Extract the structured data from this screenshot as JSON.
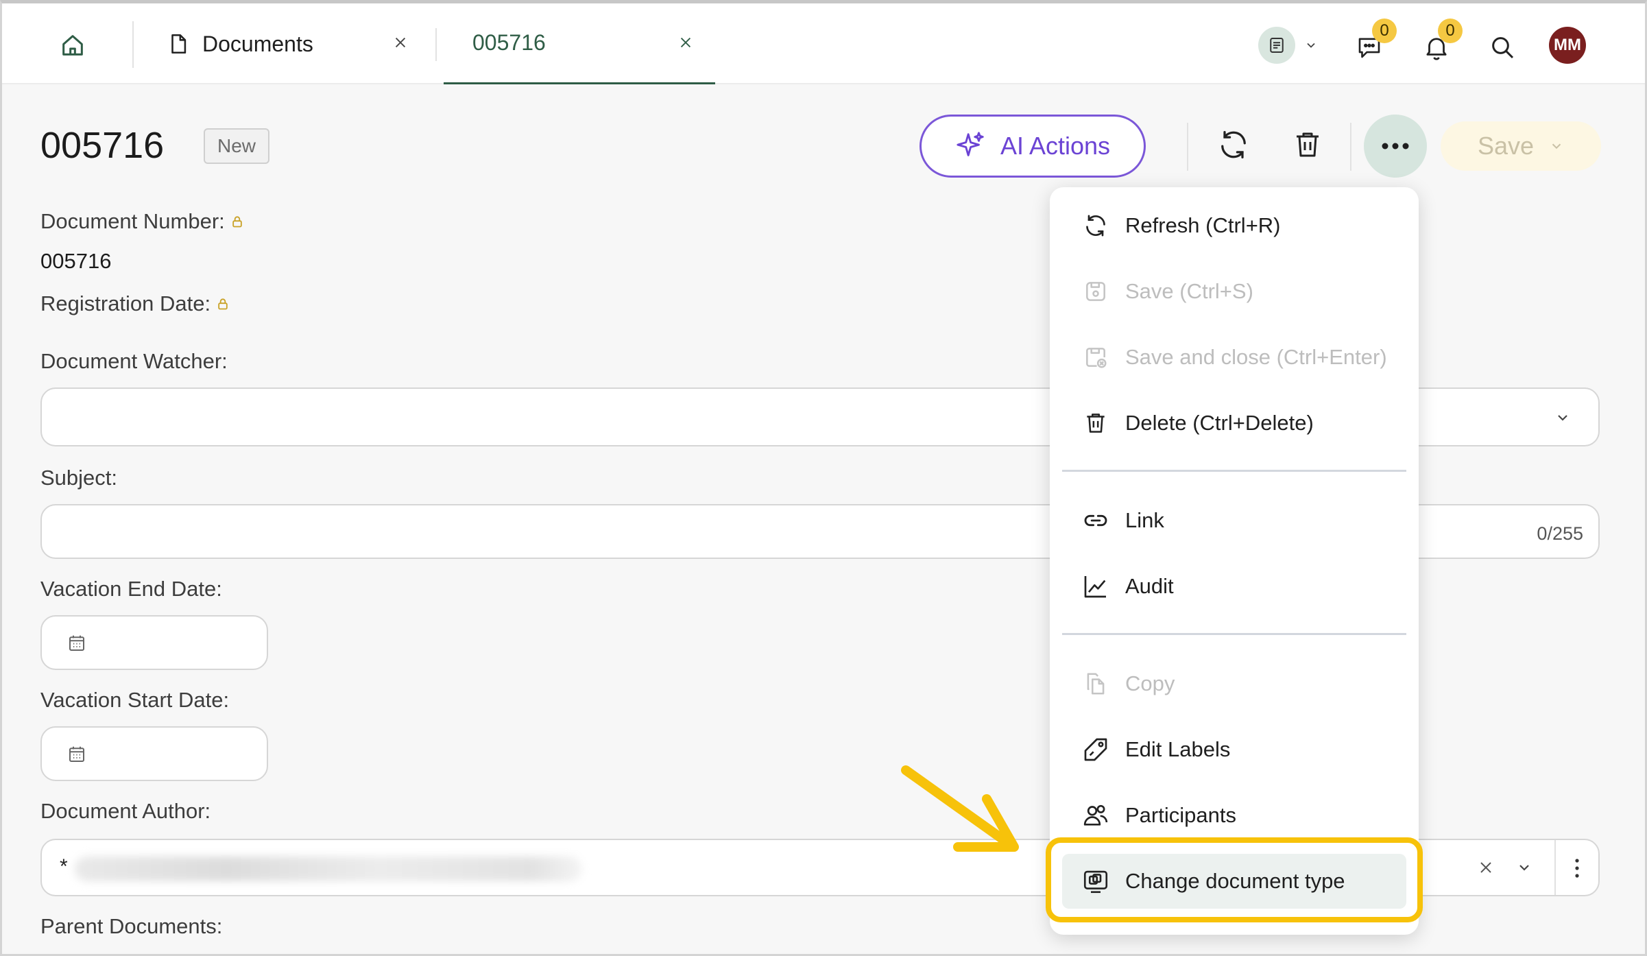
{
  "tabs": [
    {
      "label": "Documents"
    },
    {
      "label": "005716"
    }
  ],
  "notifications": {
    "chat_count": "0",
    "bell_count": "0"
  },
  "user": {
    "initials": "MM"
  },
  "header": {
    "title": "005716",
    "status": "New",
    "ai_label": "AI Actions",
    "save_label": "Save"
  },
  "form": {
    "doc_number_label": "Document Number:",
    "doc_number_value": "005716",
    "reg_date_label": "Registration Date:",
    "watcher_label": "Document Watcher:",
    "subject_label": "Subject:",
    "subject_counter": "0/255",
    "vac_end_label": "Vacation End Date:",
    "vac_start_label": "Vacation Start Date:",
    "author_label": "Document Author:",
    "author_required": "*",
    "parent_label": "Parent Documents:"
  },
  "menu": {
    "items": [
      {
        "label": "Refresh (Ctrl+R)",
        "icon": "refresh-icon",
        "enabled": true
      },
      {
        "label": "Save (Ctrl+S)",
        "icon": "save-icon",
        "enabled": false
      },
      {
        "label": "Save and close (Ctrl+Enter)",
        "icon": "save-close-icon",
        "enabled": false
      },
      {
        "label": "Delete (Ctrl+Delete)",
        "icon": "trash-icon",
        "enabled": true
      },
      {
        "label": "Link",
        "icon": "link-icon",
        "enabled": true
      },
      {
        "label": "Audit",
        "icon": "chart-line-icon",
        "enabled": true
      },
      {
        "label": "Copy",
        "icon": "copy-icon",
        "enabled": false
      },
      {
        "label": "Edit Labels",
        "icon": "tag-icon",
        "enabled": true
      },
      {
        "label": "Participants",
        "icon": "users-icon",
        "enabled": true
      },
      {
        "label": "Change document type",
        "icon": "change-type-icon",
        "enabled": true
      }
    ]
  },
  "colors": {
    "accent_green": "#2f5d46",
    "ai_purple": "#7b57d8",
    "callout_yellow": "#f7c20a",
    "badge_yellow": "#f5c842",
    "avatar_red": "#7a1f1f"
  }
}
